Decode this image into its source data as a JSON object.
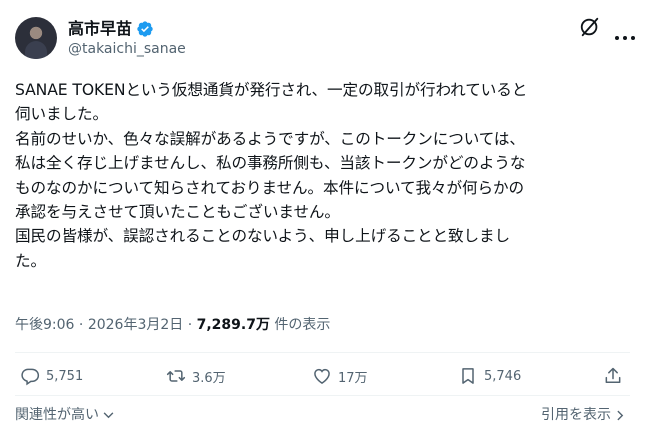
{
  "author": {
    "display_name": "高市早苗",
    "handle": "@takaichi_sanae"
  },
  "icons": {
    "avatar": "avatar-photo",
    "verified": "verified-badge-icon",
    "grok": "grok-icon",
    "more": "more-icon"
  },
  "tweet": {
    "text": "SANAE TOKENという仮想通貨が発行され、一定の取引が行われていると\n伺いました。\n名前のせいか、色々な誤解があるようですが、このトークンについては、\n私は全く存じ上げませんし、私の事務所側も、当該トークンがどのような\nものなのかについて知らされておりません。本件について我々が何らかの\n承認を与えさせて頂いたこともございません。\n国民の皆様が、誤認されることのないよう、申し上げることと致しまし\nた。"
  },
  "meta": {
    "time": "午後9:06",
    "separator1": " · ",
    "date": "2026年3月2日",
    "separator2": " · ",
    "views_count": "7,289.7万",
    "views_suffix": " 件の表示"
  },
  "actions": {
    "replies": "5,751",
    "reposts": "3.6万",
    "likes": "17万",
    "bookmarks": "5,746"
  },
  "footer": {
    "sort_label": "関連性が高い",
    "quotes_label": "引用を表示"
  },
  "colors": {
    "text": "#0f1419",
    "muted": "#536471",
    "verified": "#1d9bf0",
    "divider": "#eff3f4"
  }
}
